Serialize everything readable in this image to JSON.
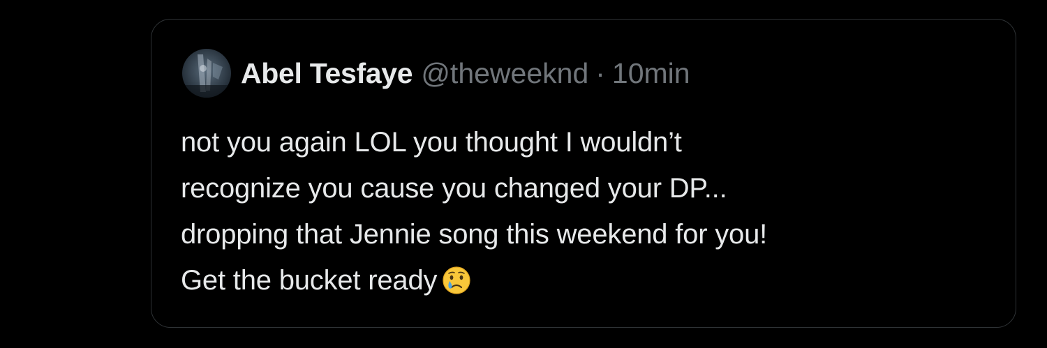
{
  "tweet": {
    "author_name": "Abel Tesfaye",
    "handle": "@theweeknd",
    "separator": "·",
    "time": "10min",
    "avatar_icon": "avatar-photo-icon",
    "lines": [
      "not you again LOL you thought I wouldn’t",
      "recognize you cause you changed your DP...",
      "dropping that Jennie song this weekend for you!",
      "Get the bucket ready"
    ],
    "emoji": "crying-face-emoji"
  },
  "colors": {
    "background": "#000000",
    "border": "#2f3336",
    "primary_text": "#e7e9ea",
    "secondary_text": "#71767b",
    "emoji_yellow": "#f9c73a",
    "tear_blue": "#4fa3e0"
  }
}
